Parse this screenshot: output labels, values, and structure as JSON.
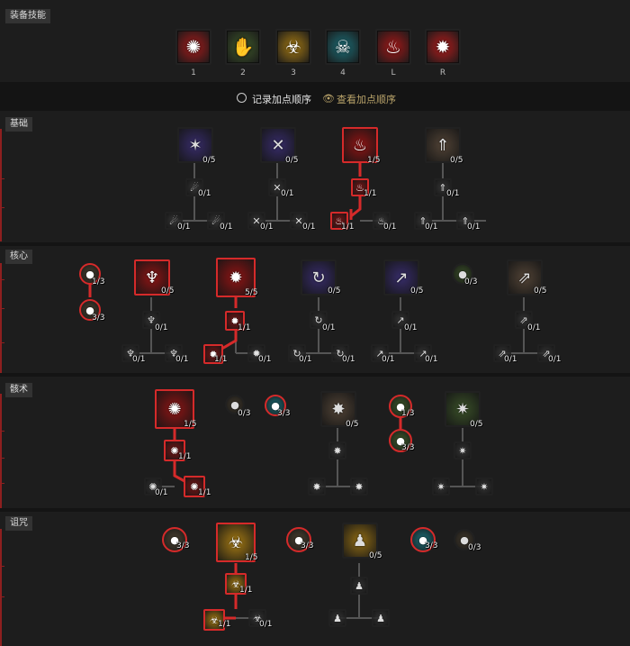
{
  "equip_title": "装备技能",
  "equip_slots": [
    {
      "key": "1",
      "icon": "blood-spatter-icon",
      "glyph": "✺",
      "color": "#a61b1b"
    },
    {
      "key": "2",
      "icon": "bone-hand-icon",
      "glyph": "✋",
      "color": "#3f5a2a"
    },
    {
      "key": "3",
      "icon": "corpse-explosion-icon",
      "glyph": "☣",
      "color": "#a57a13"
    },
    {
      "key": "4",
      "icon": "skull-cloud-icon",
      "glyph": "☠",
      "color": "#1c6f78"
    },
    {
      "key": "L",
      "icon": "blood-claw-icon",
      "glyph": "♨",
      "color": "#a31818"
    },
    {
      "key": "R",
      "icon": "blood-orb-icon",
      "glyph": "✹",
      "color": "#b21c1c"
    }
  ],
  "order_label": "记录加点顺序",
  "view_order_label": "查看加点顺序",
  "sections": [
    {
      "label": "基础"
    },
    {
      "label": "核心"
    },
    {
      "label": "骸术"
    },
    {
      "label": "诅咒"
    }
  ],
  "nodes": [
    {
      "rank": "0/5",
      "icon": "reap-icon"
    },
    {
      "rank": "0/5",
      "icon": "decompose-icon"
    },
    {
      "rank": "1/5",
      "icon": "hemorrhage-icon"
    },
    {
      "rank": "0/5",
      "icon": "bone-splinters-icon"
    },
    {
      "rank": "0/1",
      "icon": "enhanced-reap-icon"
    },
    {
      "rank": "0/1",
      "icon": "enhanced-decompose-icon"
    },
    {
      "rank": "1/1",
      "icon": "enhanced-hemorrhage-icon"
    },
    {
      "rank": "0/1",
      "icon": "enhanced-bone-splinters-icon"
    },
    {
      "rank": "0/1",
      "icon": "upgrade-icon"
    },
    {
      "rank": "0/1",
      "icon": "upgrade-icon"
    },
    {
      "rank": "0/1",
      "icon": "upgrade-icon"
    },
    {
      "rank": "0/1",
      "icon": "upgrade-icon"
    },
    {
      "rank": "1/1",
      "icon": "upgrade-icon"
    },
    {
      "rank": "0/1",
      "icon": "upgrade-icon"
    },
    {
      "rank": "0/1",
      "icon": "upgrade-icon"
    },
    {
      "rank": "0/1",
      "icon": "upgrade-icon"
    },
    {
      "rank": "1/3",
      "icon": "passive-icon"
    },
    {
      "rank": "3/3",
      "icon": "passive-icon"
    },
    {
      "rank": "0/5",
      "icon": "blood-lance-icon"
    },
    {
      "rank": "5/5",
      "icon": "blood-surge-icon"
    },
    {
      "rank": "0/5",
      "icon": "sever-icon"
    },
    {
      "rank": "0/5",
      "icon": "bone-spear-icon"
    },
    {
      "rank": "0/3",
      "icon": "passive-icon"
    },
    {
      "rank": "0/5",
      "icon": "bone-spirit-icon"
    },
    {
      "rank": "0/1",
      "icon": "enhanced-icon"
    },
    {
      "rank": "1/1",
      "icon": "enhanced-icon"
    },
    {
      "rank": "0/1",
      "icon": "enhanced-icon"
    },
    {
      "rank": "0/1",
      "icon": "enhanced-icon"
    },
    {
      "rank": "0/1",
      "icon": "enhanced-icon"
    },
    {
      "rank": "0/1",
      "icon": "upgrade-icon"
    },
    {
      "rank": "0/1",
      "icon": "upgrade-icon"
    },
    {
      "rank": "1/1",
      "icon": "upgrade-icon"
    },
    {
      "rank": "0/1",
      "icon": "upgrade-icon"
    },
    {
      "rank": "0/1",
      "icon": "upgrade-icon"
    },
    {
      "rank": "0/1",
      "icon": "upgrade-icon"
    },
    {
      "rank": "0/1",
      "icon": "upgrade-icon"
    },
    {
      "rank": "0/1",
      "icon": "upgrade-icon"
    },
    {
      "rank": "0/1",
      "icon": "upgrade-icon"
    },
    {
      "rank": "0/1",
      "icon": "upgrade-icon"
    },
    {
      "rank": "1/5",
      "icon": "corpse-explosion-icon"
    },
    {
      "rank": "0/3",
      "icon": "passive-icon"
    },
    {
      "rank": "3/3",
      "icon": "passive-icon"
    },
    {
      "rank": "0/5",
      "icon": "corpse-tendrils-icon"
    },
    {
      "rank": "1/3",
      "icon": "passive-icon"
    },
    {
      "rank": "3/3",
      "icon": "passive-icon"
    },
    {
      "rank": "0/5",
      "icon": "bone-prison-icon"
    },
    {
      "rank": "1/1",
      "icon": "enhanced-icon"
    },
    {
      "rank": "1/1",
      "icon": "upgrade-icon"
    },
    {
      "rank": "0/1",
      "icon": "upgrade-icon"
    },
    {
      "rank": "3/3",
      "icon": "passive-icon"
    },
    {
      "rank": "1/5",
      "icon": "decrepify-icon"
    },
    {
      "rank": "3/3",
      "icon": "passive-icon"
    },
    {
      "rank": "0/5",
      "icon": "iron-maiden-icon"
    },
    {
      "rank": "3/3",
      "icon": "passive-icon"
    },
    {
      "rank": "0/3",
      "icon": "passive-icon"
    },
    {
      "rank": "1/1",
      "icon": "enhanced-icon"
    },
    {
      "rank": "1/1",
      "icon": "upgrade-icon"
    },
    {
      "rank": "0/1",
      "icon": "upgrade-icon"
    }
  ]
}
